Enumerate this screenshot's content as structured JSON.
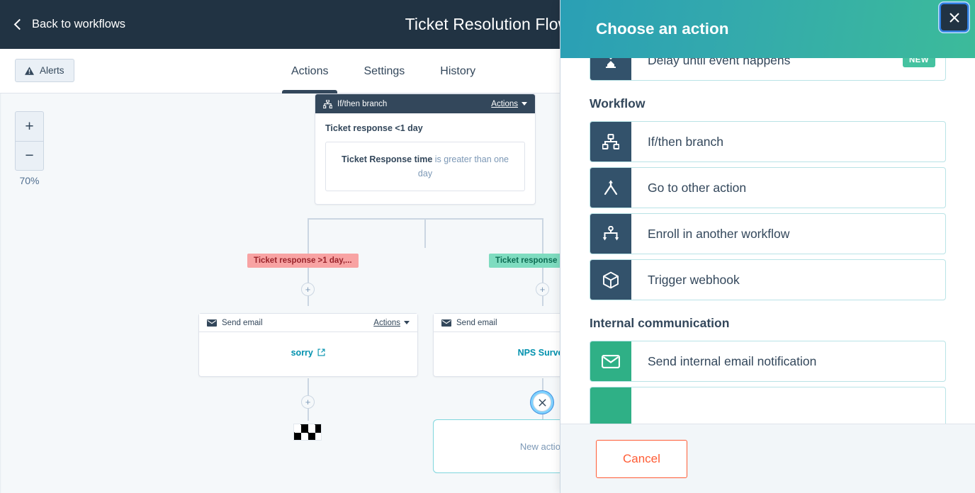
{
  "topbar": {
    "back_label": "Back to workflows",
    "flow_title": "Ticket Resolution Flow",
    "back_icon": "chevron-left-icon"
  },
  "subnav": {
    "alerts_label": "Alerts",
    "alerts_icon": "warning-triangle-icon",
    "tabs": [
      {
        "label": "Actions",
        "active": true
      },
      {
        "label": "Settings",
        "active": false
      },
      {
        "label": "History",
        "active": false
      }
    ]
  },
  "canvas": {
    "zoom": {
      "in_label": "+",
      "out_label": "−",
      "percent": "70%"
    },
    "branch_card": {
      "header_title": "If/then branch",
      "header_icon": "branch-icon",
      "actions_label": "Actions",
      "branch_name": "Ticket response <1 day",
      "condition_bold": "Ticket Response time",
      "condition_rest": " is greater than one day"
    },
    "pills": [
      {
        "label": "Ticket response >1 day,...",
        "color": "#f8a3a3"
      },
      {
        "label": "Ticket response",
        "color": "#7fdcc0"
      }
    ],
    "email_cards": [
      {
        "header_title": "Send email",
        "header_icon": "envelope-icon",
        "actions_label": "Actions",
        "link_label": "sorry",
        "link_icon": "external-link-icon"
      },
      {
        "header_title": "Send email",
        "header_icon": "envelope-icon",
        "link_label": "NPS Survey"
      }
    ],
    "plus_label": "+",
    "close_icon": "close-icon",
    "new_action_label": "New action",
    "checker_icon": "checkered-flag-icon"
  },
  "panel": {
    "title": "Choose an action",
    "close_icon": "close-icon",
    "cancel_label": "Cancel",
    "top_item": {
      "label": "Delay until event happens",
      "icon": "hourglass-icon",
      "badge": "NEW",
      "icon_color": "#33526b"
    },
    "groups": [
      {
        "title": "Workflow",
        "items": [
          {
            "label": "If/then branch",
            "icon": "branch-icon",
            "icon_color": "#33526b"
          },
          {
            "label": "Go to other action",
            "icon": "goto-action-icon",
            "icon_color": "#33526b"
          },
          {
            "label": "Enroll in another workflow",
            "icon": "enroll-workflow-icon",
            "icon_color": "#33526b"
          },
          {
            "label": "Trigger webhook",
            "icon": "cube-icon",
            "icon_color": "#33526b"
          }
        ]
      },
      {
        "title": "Internal communication",
        "items": [
          {
            "label": "Send internal email notification",
            "icon": "envelope-icon",
            "icon_color": "#2fb086"
          }
        ]
      }
    ]
  }
}
